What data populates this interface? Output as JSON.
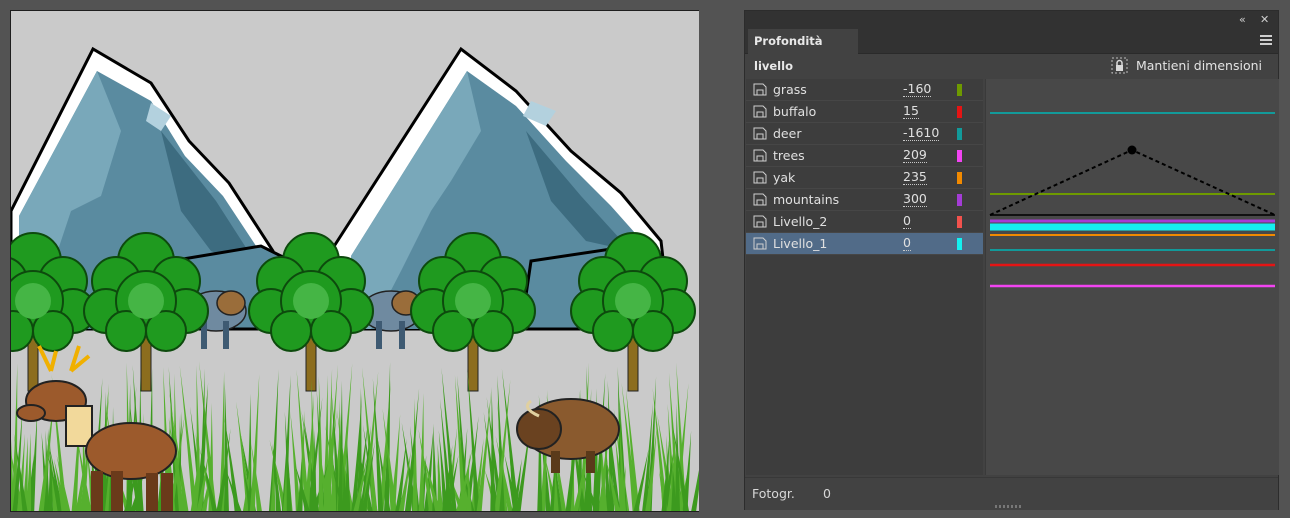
{
  "panel": {
    "title": "Profondità livello",
    "keep_size_label": "Mantieni dimensioni",
    "layers": [
      {
        "name": "grass",
        "depth": "-160",
        "color": "#6e9a00"
      },
      {
        "name": "buffalo",
        "depth": "15",
        "color": "#e51414"
      },
      {
        "name": "deer",
        "depth": "-1610",
        "color": "#129a9a"
      },
      {
        "name": "trees",
        "depth": "209",
        "color": "#f244f2"
      },
      {
        "name": "yak",
        "depth": "235",
        "color": "#f28a00"
      },
      {
        "name": "mountains",
        "depth": "300",
        "color": "#a43cd6"
      },
      {
        "name": "Livello_2",
        "depth": "0",
        "color": "#f2524d"
      },
      {
        "name": "Livello_1",
        "depth": "0",
        "color": "#14f0f0"
      }
    ],
    "selected_layer": "Livello_1",
    "status_label": "Fotogr.",
    "status_value": "0"
  },
  "icons": {
    "collapse": "double-chevron-left-icon",
    "close": "close-icon",
    "menu": "hamburger-menu-icon",
    "lock": "padlock-icon",
    "layer": "layer-page-icon"
  }
}
